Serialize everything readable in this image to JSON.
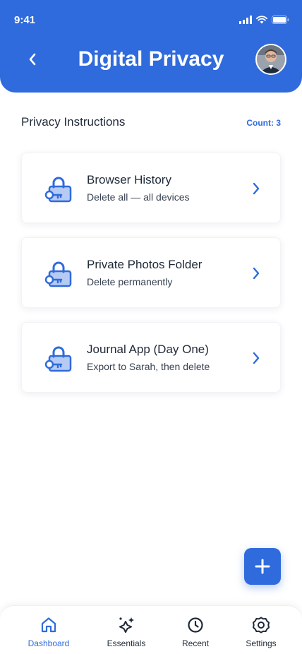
{
  "status_bar": {
    "time": "9:41"
  },
  "header": {
    "title": "Digital Privacy"
  },
  "section": {
    "title": "Privacy Instructions",
    "count": "Count: 3"
  },
  "items": [
    {
      "name": "Browser History",
      "description": "Delete all — all devices"
    },
    {
      "name": "Private Photos Folder",
      "description": "Delete permanently"
    },
    {
      "name": "Journal App (Day One)",
      "description": "Export to Sarah, then delete"
    }
  ],
  "nav": [
    {
      "label": "Dashboard",
      "icon": "home-icon",
      "active": true
    },
    {
      "label": "Essentials",
      "icon": "sparkle-icon",
      "active": false
    },
    {
      "label": "Recent",
      "icon": "clock-icon",
      "active": false
    },
    {
      "label": "Settings",
      "icon": "gear-icon",
      "active": false
    }
  ],
  "colors": {
    "primary": "#2f6bdc",
    "text": "#1f2937",
    "background": "#ffffff"
  }
}
